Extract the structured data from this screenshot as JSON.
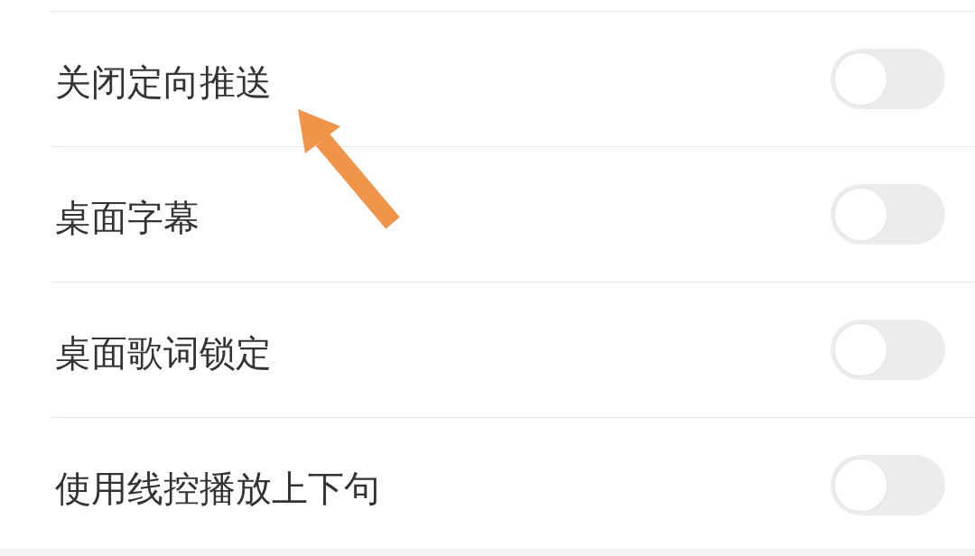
{
  "settings": [
    {
      "label": "关闭定向推送",
      "on": false
    },
    {
      "label": "桌面字幕",
      "on": false
    },
    {
      "label": "桌面歌词锁定",
      "on": false
    },
    {
      "label": "使用线控播放上下句",
      "on": false
    }
  ],
  "overlays": [
    {
      "kind": "arrow"
    }
  ]
}
